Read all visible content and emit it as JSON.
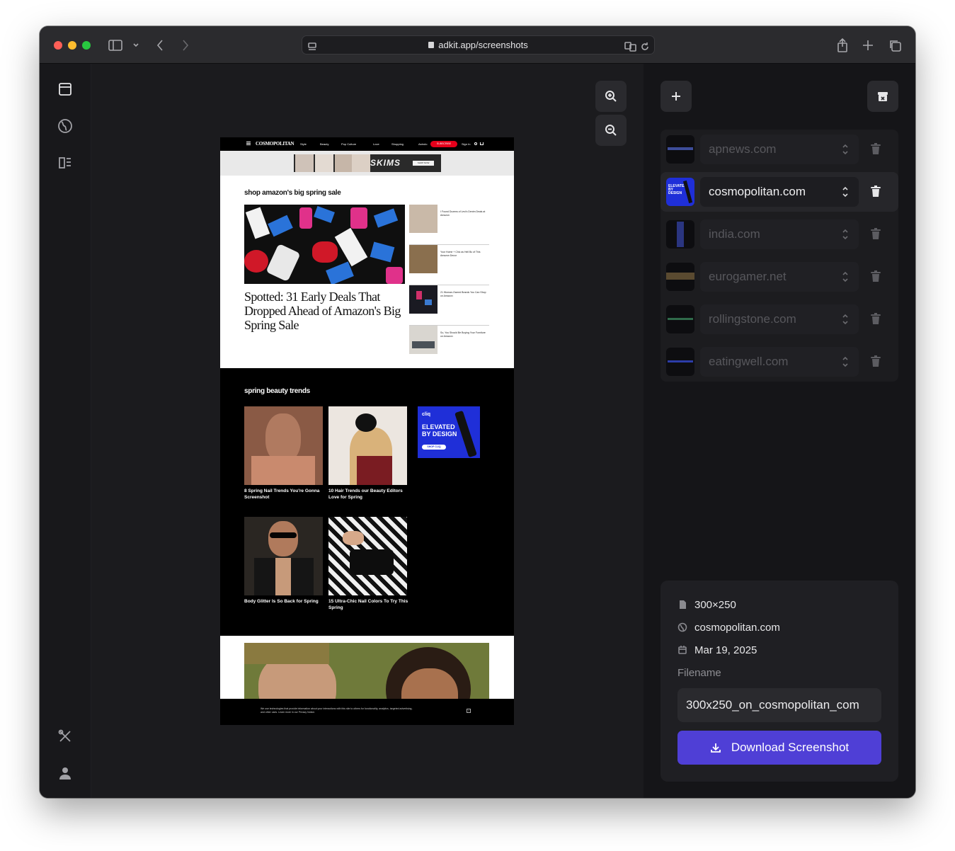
{
  "browser": {
    "url": "adkit.app/screenshots"
  },
  "panel": {
    "sites": [
      {
        "name": "apnews.com",
        "active": false
      },
      {
        "name": "cosmopolitan.com",
        "active": true
      },
      {
        "name": "india.com",
        "active": false
      },
      {
        "name": "eurogamer.net",
        "active": false
      },
      {
        "name": "rollingstone.com",
        "active": false
      },
      {
        "name": "eatingwell.com",
        "active": false
      }
    ],
    "info": {
      "size": "300×250",
      "site": "cosmopolitan.com",
      "date": "Mar 19, 2025",
      "filename_label": "Filename",
      "filename_value": "300x250_on_cosmopolitan_com",
      "download_label": "Download Screenshot"
    }
  },
  "preview": {
    "logo": "COSMOPOLITAN",
    "nav": [
      "Style",
      "Beauty",
      "Pop Culture",
      "Love",
      "Shopping",
      "Astrolo"
    ],
    "subscribe": "SUBSCRIBE",
    "signin": "Sign In",
    "ad_brand": "SKIMS",
    "ad_cta": "SHOP NOW",
    "section1_title": "shop amazon's big spring sale",
    "headline": "Spotted: 31 Early Deals That Dropped Ahead of Amazon's Big Spring Sale",
    "side_articles": [
      "I Found Dozens of Levi's Denim Deals at Amazon",
      "Your Home + Chic as Hell Bc of This Amazon Decor",
      "21 Woman-Owned Brands You Can Shop on Amazon",
      "So, You Should Be Buying Your Furniture on Amazon"
    ],
    "section2_title": "spring beauty trends",
    "cards": [
      "8 Spring Nail Trends You're Gonna Screenshot",
      "10 Hair Trends our Beauty Editors Love for Spring",
      "Body Glitter Is So Back for Spring",
      "15 Ultra-Chic Nail Colors To Try This Spring"
    ],
    "cliq_brand": "cliq",
    "cliq_headline": "ELEVATED BY DESIGN",
    "cliq_cta": "SHOP CLIQ",
    "cookie_text": "We use technologies that provide information about your interactions with this site to others for functionality, analytics, targeted advertising, and other uses. Learn more in our Privacy Notice."
  },
  "colors": {
    "accent": "#4f3fd6",
    "cosmo_red": "#e4001b",
    "cliq_blue": "#1f2fd8"
  }
}
